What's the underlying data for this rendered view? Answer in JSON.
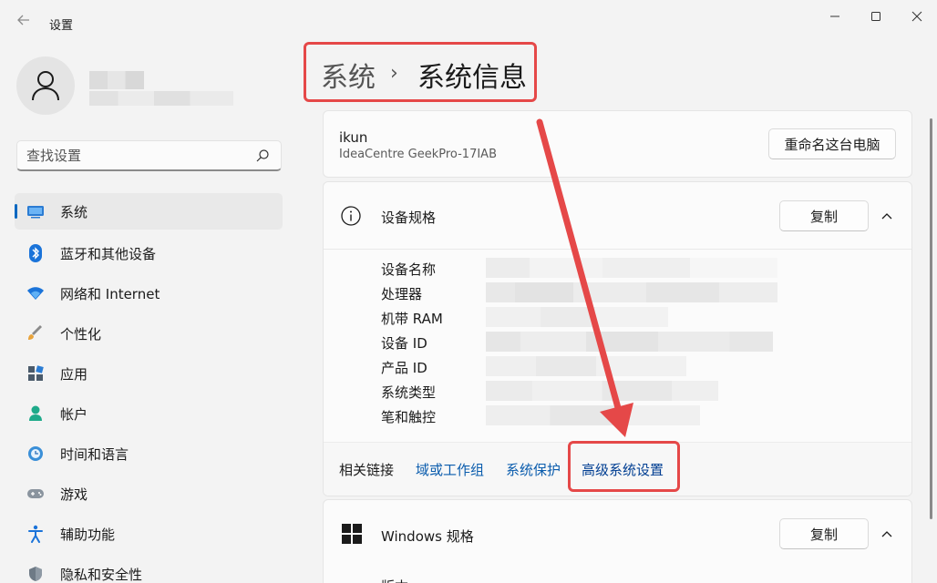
{
  "app": {
    "title": "设置"
  },
  "search": {
    "placeholder": "查找设置"
  },
  "sidebar": {
    "items": [
      {
        "label": "系统",
        "icon": "system-icon",
        "active": true
      },
      {
        "label": "蓝牙和其他设备",
        "icon": "bluetooth-icon"
      },
      {
        "label": "网络和 Internet",
        "icon": "wifi-icon"
      },
      {
        "label": "个性化",
        "icon": "brush-icon"
      },
      {
        "label": "应用",
        "icon": "apps-icon"
      },
      {
        "label": "帐户",
        "icon": "account-icon"
      },
      {
        "label": "时间和语言",
        "icon": "clock-globe-icon"
      },
      {
        "label": "游戏",
        "icon": "gamepad-icon"
      },
      {
        "label": "辅助功能",
        "icon": "accessibility-icon"
      },
      {
        "label": "隐私和安全性",
        "icon": "shield-icon"
      }
    ]
  },
  "breadcrumb": {
    "parent": "系统",
    "separator": "›",
    "current": "系统信息"
  },
  "pc": {
    "name": "ikun",
    "model": "IdeaCentre GeekPro-17IAB",
    "rename_label": "重命名这台电脑"
  },
  "device_specs": {
    "title": "设备规格",
    "copy_label": "复制",
    "rows": [
      "设备名称",
      "处理器",
      "机带 RAM",
      "设备 ID",
      "产品 ID",
      "系统类型",
      "笔和触控"
    ]
  },
  "related_links": {
    "label": "相关链接",
    "links": [
      "域或工作组",
      "系统保护",
      "高级系统设置"
    ]
  },
  "windows_specs": {
    "title": "Windows 规格",
    "copy_label": "复制",
    "first_row": "版本"
  },
  "colors": {
    "accent": "#0067c0",
    "highlight": "#e54848",
    "link": "#0a5cad"
  }
}
